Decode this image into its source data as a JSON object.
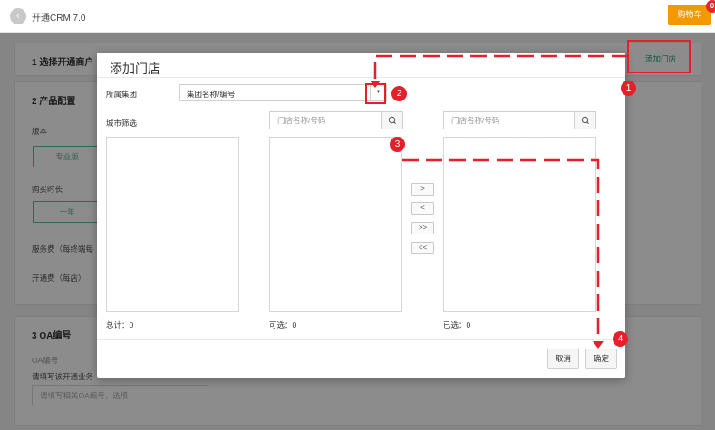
{
  "topbar": {
    "back_icon": "chevron-left-icon",
    "app_title": "开通CRM 7.0",
    "cart_label": "购物车",
    "cart_badge": "0"
  },
  "background": {
    "section1_title": "1 选择开通商户",
    "add_store_label": "添加门店",
    "section2_title": "2 产品配置",
    "version_label": "版本",
    "version_value": "专业版",
    "duration_label": "购买时长",
    "duration_value": "一年",
    "service_fee_label": "服务费（每终端每",
    "opening_fee_label": "开通费（每店）",
    "section3_title": "3 OA编号",
    "oa_label": "OA编号",
    "oa_hint": "请填写该开通业务",
    "oa_placeholder": "请填写相关OA编号，选填"
  },
  "modal": {
    "title": "添加门店",
    "group_label": "所属集团",
    "group_select_value": "集团名称/编号",
    "city_filter_label": "城市筛选",
    "available_search_placeholder": "门店名称/号码",
    "selected_search_placeholder": "门店名称/号码",
    "total_label": "总计：0",
    "available_label": "可选：0",
    "selected_label": "已选：0",
    "transfer_buttons": [
      ">",
      "<",
      ">>",
      "<<"
    ],
    "cancel_label": "取消",
    "confirm_label": "确定"
  },
  "annotations": {
    "color": "#e5202a",
    "steps": [
      "1",
      "2",
      "3",
      "4"
    ]
  },
  "colors": {
    "accent_orange": "#f39800",
    "accent_green": "#1e9e6f",
    "annotation_red": "#e5202a"
  }
}
